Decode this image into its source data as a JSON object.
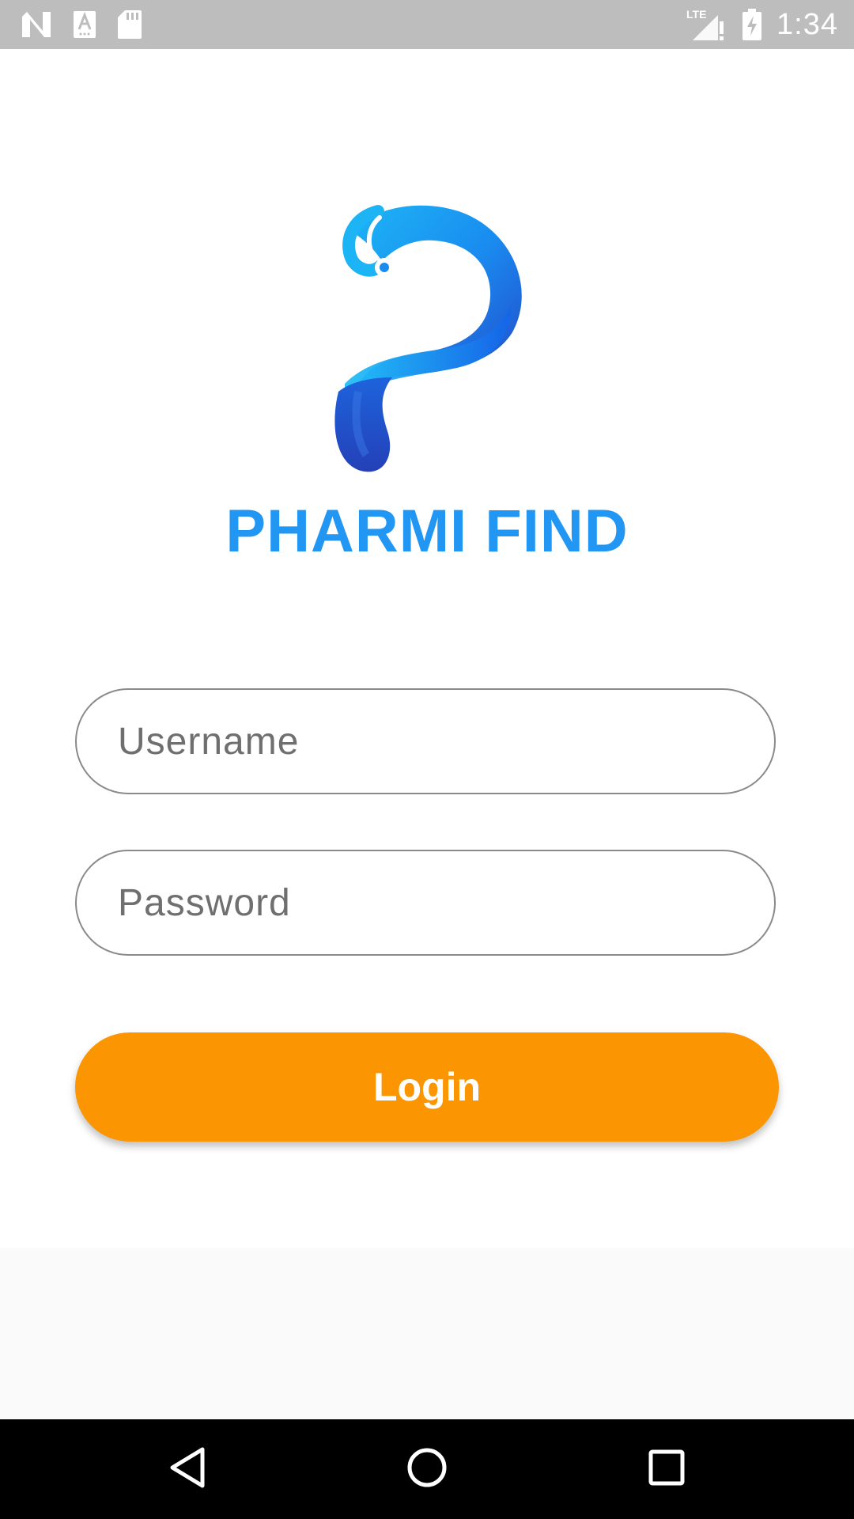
{
  "status_bar": {
    "time": "1:34",
    "network_label": "LTE",
    "left_icons": [
      "n-logo-icon",
      "keyboard-a-icon",
      "sd-card-icon"
    ],
    "right_icons": [
      "signal-alert-icon",
      "battery-charging-icon"
    ]
  },
  "app": {
    "title": "PHARMI FIND",
    "logo": "pharmi-p-logo"
  },
  "form": {
    "username_placeholder": "Username",
    "password_placeholder": "Password",
    "login_label": "Login"
  },
  "nav_bar": {
    "buttons": [
      "back-icon",
      "home-icon",
      "recents-icon"
    ]
  },
  "colors": {
    "status_bar": "#bdbdbd",
    "title": "#2196f3",
    "login_button": "#fb9602",
    "input_border": "#8a8a8a",
    "nav_bar": "#000000"
  }
}
